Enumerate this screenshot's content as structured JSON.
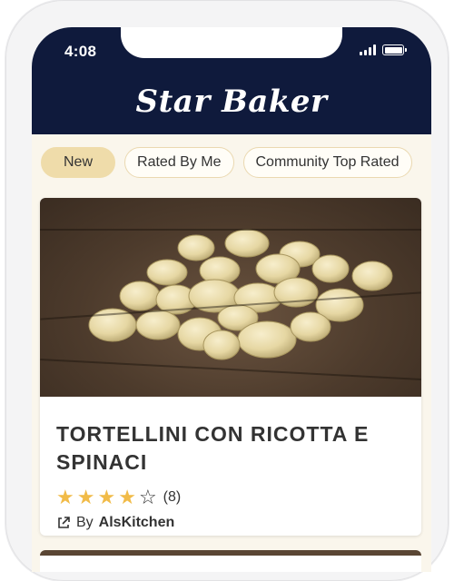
{
  "status_bar": {
    "time": "4:08"
  },
  "app": {
    "title": "Star Baker"
  },
  "tabs": [
    {
      "label": "New",
      "active": true
    },
    {
      "label": "Rated By Me",
      "active": false
    },
    {
      "label": "Community Top Rated",
      "active": false
    }
  ],
  "recipe": {
    "title": "TORTELLINI CON RICOTTA E SPINACI",
    "rating": 4,
    "max_rating": 5,
    "rating_count": "(8)",
    "author_prefix": "By",
    "author": "AlsKitchen",
    "image_icon": "tortellini-photo"
  },
  "colors": {
    "header": "#0f1a3c",
    "background": "#faf6ec",
    "active_tab": "#efdcaa",
    "star": "#f1bb48"
  }
}
